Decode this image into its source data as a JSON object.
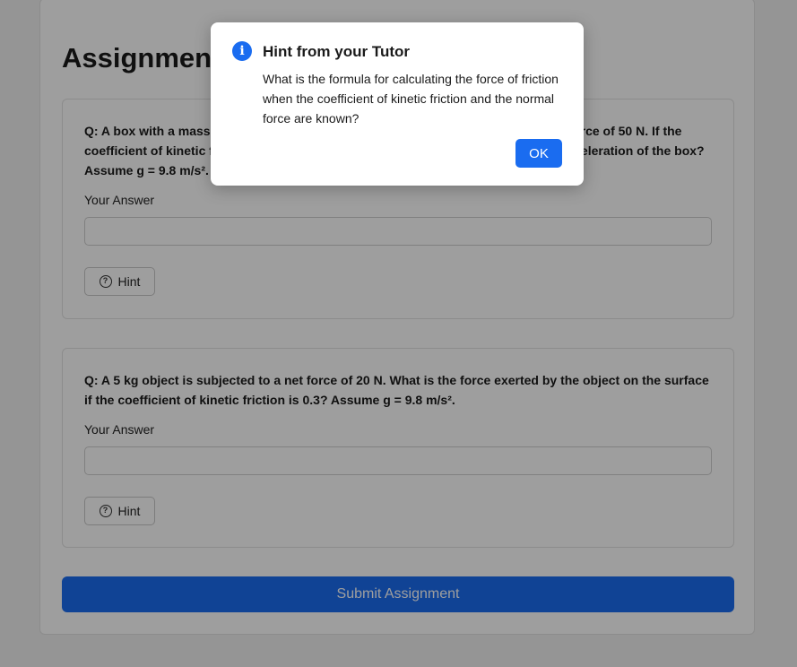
{
  "page": {
    "title": "Assignment",
    "submit_label": "Submit Assignment"
  },
  "questions": [
    {
      "text": "Q: A box with a mass of 10 kg is being pushed across a horizontal surface with a force of 50 N. If the coefficient of kinetic friction between the box and the surface is 0.2, what is the acceleration of the box? Assume g = 9.8 m/s².",
      "answer_label": "Your Answer",
      "answer_value": "",
      "hint_label": "Hint"
    },
    {
      "text": "Q: A 5 kg object is subjected to a net force of 20 N. What is the force exerted by the object on the surface if the coefficient of kinetic friction is 0.3? Assume g = 9.8 m/s².",
      "answer_label": "Your Answer",
      "answer_value": "",
      "hint_label": "Hint"
    }
  ],
  "dialog": {
    "icon": "info-icon",
    "icon_glyph": "i",
    "title": "Hint from your Tutor",
    "body": "What is the formula for calculating the force of friction when the coefficient of kinetic friction and the normal force are known?",
    "ok_label": "OK"
  },
  "colors": {
    "accent": "#1a6cf0",
    "overlay": "rgba(0,0,0,0.38)"
  }
}
